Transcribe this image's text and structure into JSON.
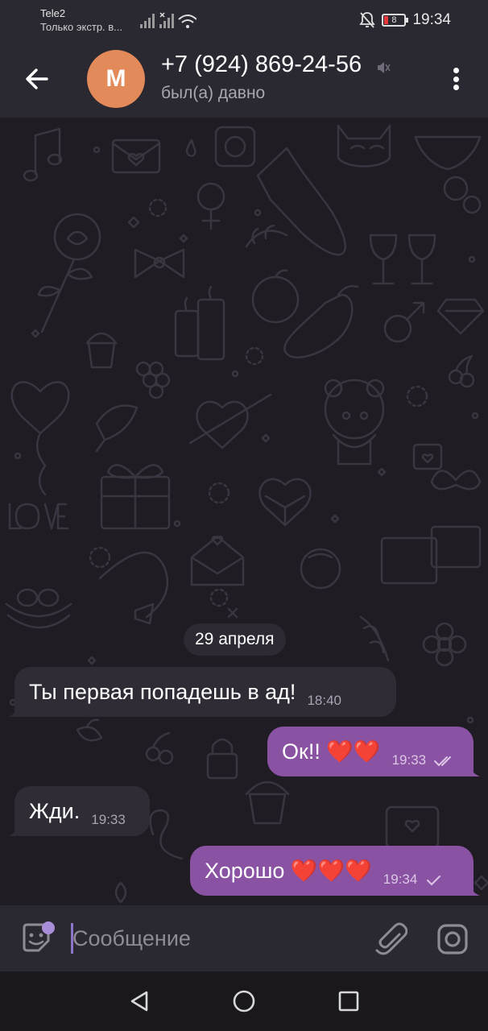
{
  "status_bar": {
    "carrier": "Tele2",
    "carrier_subtitle": "Только экстр. в...",
    "battery": "8",
    "time": "19:34"
  },
  "header": {
    "avatar_letter": "M",
    "name": "+7 (924) 869-24-56",
    "status": "был(а) давно"
  },
  "chat": {
    "date_separator": "29 апреля",
    "messages": [
      {
        "direction": "incoming",
        "text": "Ты первая попадешь в ад!",
        "time": "18:40"
      },
      {
        "direction": "outgoing",
        "text": "Ок!! ❤️❤️",
        "time": "19:33",
        "status": "read"
      },
      {
        "direction": "incoming",
        "text": "Жди.",
        "time": "19:33"
      },
      {
        "direction": "outgoing",
        "text": "Хорошо ❤️❤️❤️",
        "time": "19:34",
        "status": "sent"
      }
    ]
  },
  "input": {
    "placeholder": "Сообщение",
    "value": ""
  },
  "colors": {
    "accent": "#8a52a2",
    "avatar": "#e38a5b",
    "background": "#1f1c23"
  }
}
